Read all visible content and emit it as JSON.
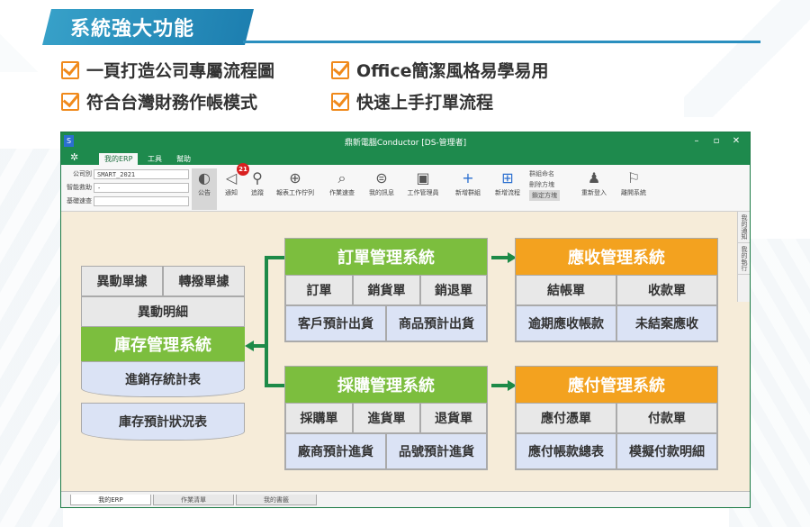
{
  "header": {
    "banner_title": "系統強大功能",
    "features": [
      "一頁打造公司專屬流程圖",
      "Office簡潔風格易學易用",
      "符合台灣財務作帳模式",
      "快速上手打單流程"
    ]
  },
  "window": {
    "title": "鼎新電腦Conductor [DS-管理者]",
    "logo": "S",
    "controls": [
      "–",
      "▫",
      "✕"
    ],
    "menu": [
      "我的ERP",
      "工具",
      "幫助"
    ],
    "fields": [
      {
        "label": "公司別",
        "value": "SMART_2021"
      },
      {
        "label": "智能救助",
        "value": "-"
      },
      {
        "label": "基礎速查",
        "value": ""
      }
    ],
    "ribbon_buttons": [
      {
        "label": "公告",
        "icon": "announce-icon"
      },
      {
        "label": "通知",
        "icon": "notify-icon"
      },
      {
        "label": "追蹤",
        "icon": "track-icon"
      },
      {
        "label": "報表工作佇列",
        "icon": "report-queue-icon"
      },
      {
        "label": "作業速查",
        "icon": "search-icon"
      },
      {
        "label": "我的訊息",
        "icon": "message-icon"
      },
      {
        "label": "工作管理員",
        "icon": "task-manager-icon"
      },
      {
        "label": "新增群組",
        "icon": "add-group-icon"
      },
      {
        "label": "新增流程",
        "icon": "add-flow-icon"
      },
      {
        "label": "重新登入",
        "icon": "relogin-icon"
      },
      {
        "label": "離開系統",
        "icon": "exit-icon"
      }
    ],
    "notification_count": "21",
    "small_items": [
      "群組命名",
      "刪除方塊",
      "鎖定方塊"
    ],
    "side_tabs": [
      "我的通知",
      "我的執行"
    ],
    "bottom_tabs": [
      "我的ERP",
      "作業清單",
      "我的書籤"
    ]
  },
  "diagram": {
    "inventory": {
      "top_row": [
        "異動單據",
        "轉撥單據"
      ],
      "detail": "異動明細",
      "title": "庫存管理系統",
      "report1": "進銷存統計表",
      "report2": "庫存預計狀況表"
    },
    "order": {
      "title": "訂單管理系統",
      "row1": [
        "訂單",
        "銷貨單",
        "銷退單"
      ],
      "row2": [
        "客戶預計出貨",
        "商品預計出貨"
      ]
    },
    "receivable": {
      "title": "應收管理系統",
      "row1": [
        "結帳單",
        "收款單"
      ],
      "row2": [
        "逾期應收帳款",
        "未結案應收"
      ]
    },
    "purchase": {
      "title": "採購管理系統",
      "row1": [
        "採購單",
        "進貨單",
        "退貨單"
      ],
      "row2": [
        "廠商預計進貨",
        "品號預計進貨"
      ]
    },
    "payable": {
      "title": "應付管理系統",
      "row1": [
        "應付憑單",
        "付款單"
      ],
      "row2": [
        "應付帳款總表",
        "模擬付款明細"
      ]
    }
  }
}
